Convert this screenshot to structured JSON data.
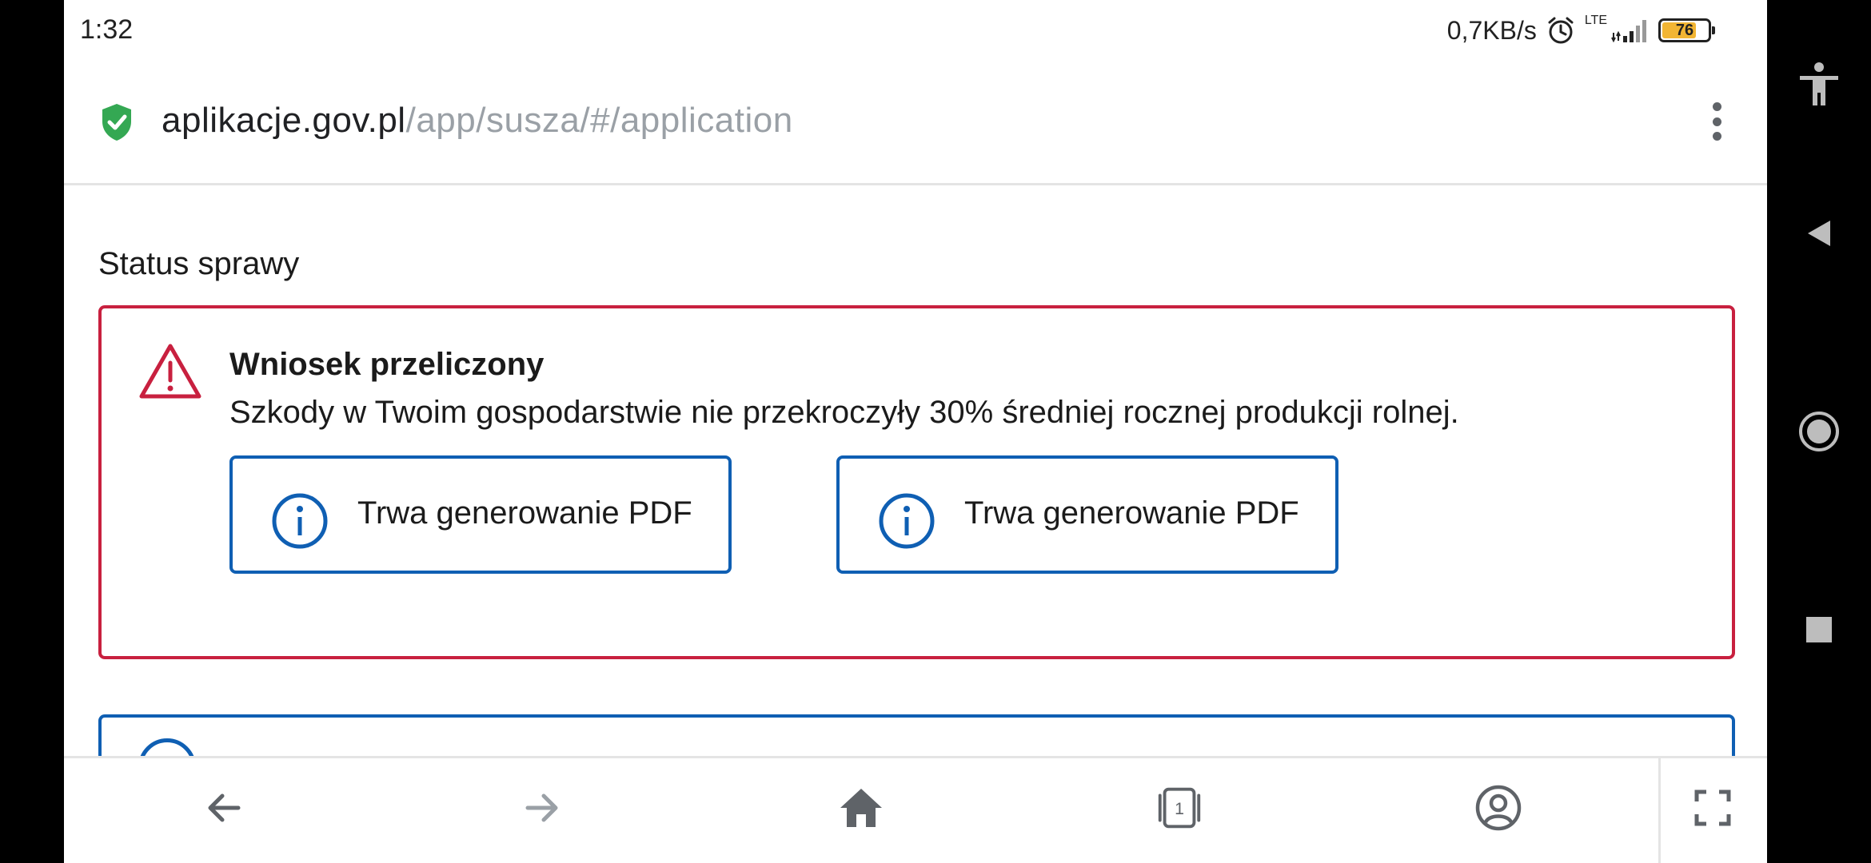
{
  "status_bar": {
    "time": "1:32",
    "net_speed": "0,7KB/s",
    "network": "LTE",
    "battery": "76",
    "battery_level": 0.76
  },
  "browser": {
    "url_host": "aplikacje.gov.pl",
    "url_path": "/app/susza/#/application",
    "secure_color": "#34a853"
  },
  "page": {
    "section_title": "Status sprawy",
    "alert": {
      "title": "Wniosek przeliczony",
      "message": "Szkody w Twoim gospodarstwie nie przekroczyły 30% średniej rocznej produkcji rolnej.",
      "border_color": "#c8203f",
      "icon": "warning-triangle-icon"
    },
    "pdf_buttons": [
      {
        "label": "Trwa generowanie PDF",
        "icon": "info-icon"
      },
      {
        "label": "Trwa generowanie PDF",
        "icon": "info-icon"
      }
    ],
    "accent_color": "#0f5fb3"
  },
  "toolbar": {
    "tab_count": "1",
    "items": [
      "back-icon",
      "forward-icon",
      "home-icon",
      "tabs-icon",
      "account-icon",
      "fullscreen-icon"
    ]
  },
  "system_nav": {
    "items": [
      "accessibility-icon",
      "nav-back-icon",
      "nav-home-icon",
      "nav-recents-icon"
    ]
  }
}
